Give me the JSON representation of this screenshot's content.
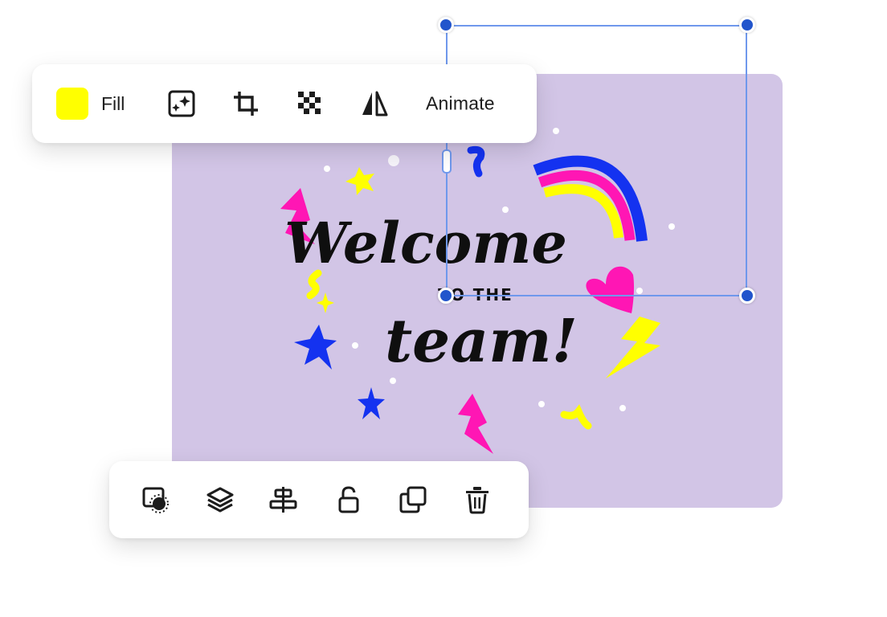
{
  "colors": {
    "canvas_bg": "#d2c5e6",
    "fill_swatch": "#ffff00",
    "selection": "#6f98ec",
    "handle": "#2255cc",
    "icon": "#1c1c1c"
  },
  "card": {
    "line1": "Welcome",
    "line2": "TO THE",
    "line3": "team!"
  },
  "top_toolbar": {
    "fill_label": "Fill",
    "effects_icon": "image-effects-icon",
    "crop_icon": "crop-icon",
    "transparency_icon": "transparency-icon",
    "flip_icon": "flip-icon",
    "animate_label": "Animate"
  },
  "bottom_toolbar": {
    "icons": [
      "remove-background-icon",
      "layers-icon",
      "align-icon",
      "lock-icon",
      "duplicate-icon",
      "trash-icon"
    ]
  }
}
